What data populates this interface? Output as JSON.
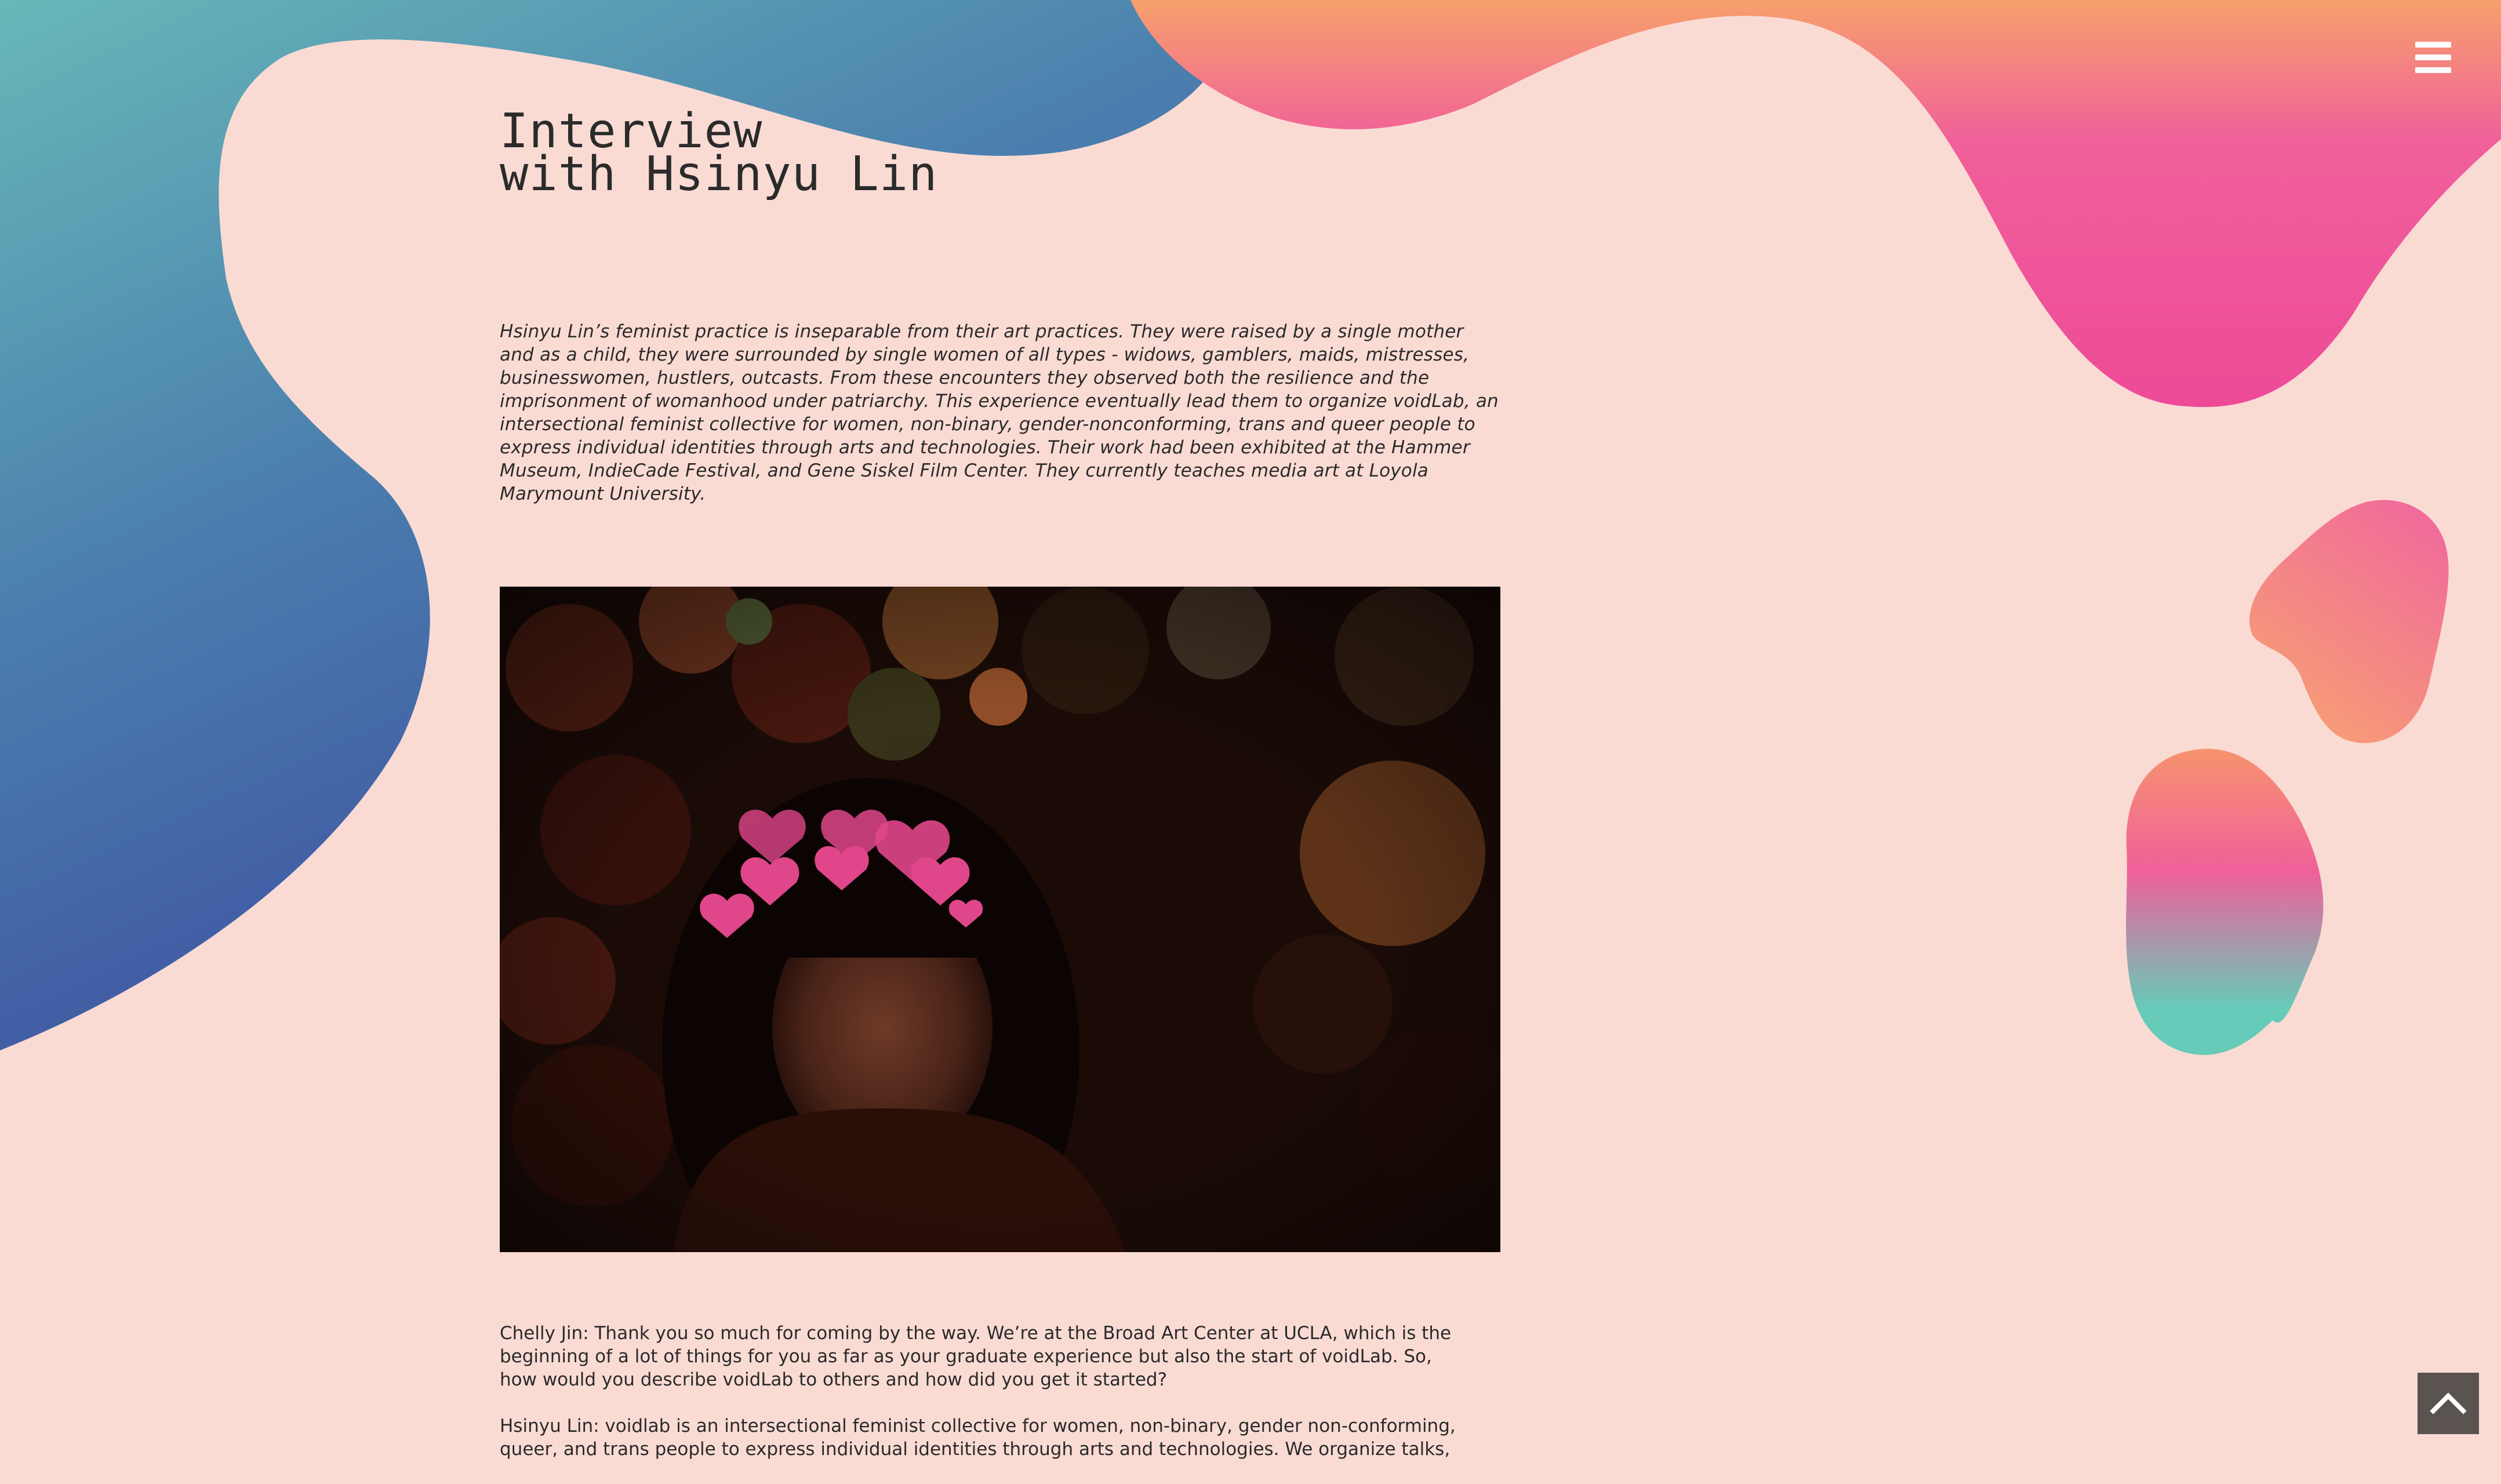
{
  "header": {
    "menu_icon": "hamburger-menu-icon"
  },
  "article": {
    "title_line1": "Interview",
    "title_line2": "with Hsinyu Lin",
    "intro": "Hsinyu Lin’s feminist practice is inseparable from their art practices. They were raised by a single mother and as a child, they were surrounded by single women of all types - widows, gamblers, maids, mistresses, businesswomen, hustlers, outcasts. From these encounters they observed both the resilience and the imprisonment of womanhood under patriarchy. This experience eventually lead them to organize voidLab, an intersectional feminist collective for women, non-binary, gender-nonconforming, trans and queer people to express individual identities through arts and technologies. Their work had been exhibited at the Hammer Museum, IndieCade Festival, and Gene Siskel Film Center. They currently teaches media art at Loyola Marymount University.",
    "paragraphs": [
      "Chelly Jin: Thank you so much for coming by the way. We’re at the Broad Art Center at UCLA, which is the beginning of a lot of things for you as far as your graduate experience but also the start of voidLab. So, how would you describe voidLab to others and how did you get it started?",
      "Hsinyu Lin: voidlab is an intersectional feminist collective for women, non-binary, gender non-conforming, queer, and trans people to express individual identities through arts and technologies. We organize talks,"
    ]
  },
  "navigation": {
    "to_top_icon": "chevron-up-icon"
  },
  "colors": {
    "background": "#fadbd4",
    "blue_gradient": [
      "#66b6b8",
      "#4e86b0",
      "#3b4fa0"
    ],
    "pink_gradient": [
      "#f59a70",
      "#f0559a",
      "#ee4a98"
    ],
    "teal_accent": "#66cbb9",
    "to_top_button": "#5a5350"
  }
}
